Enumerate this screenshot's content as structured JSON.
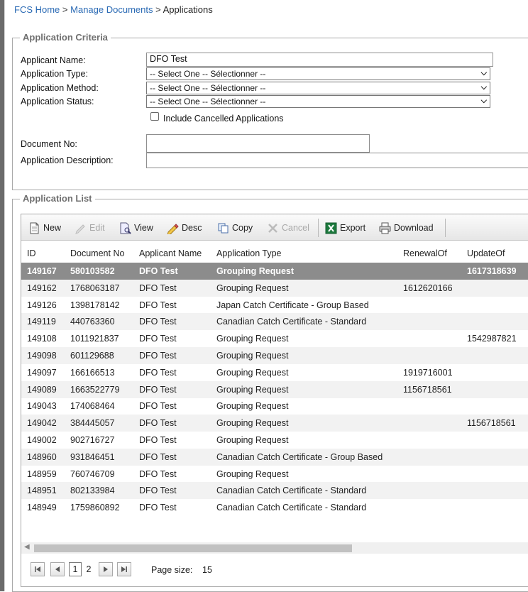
{
  "breadcrumb": {
    "home": "FCS Home",
    "sep1": ">",
    "manage": "Manage Documents",
    "sep2": ">",
    "current": "Applications"
  },
  "criteria": {
    "legend": "Application Criteria",
    "applicant_name_label": "Applicant Name:",
    "applicant_name_value": "DFO Test",
    "application_type_label": "Application Type:",
    "application_type_value": "-- Select One -- Sélectionner --",
    "application_method_label": "Application Method:",
    "application_method_value": "-- Select One -- Sélectionner --",
    "application_status_label": "Application Status:",
    "application_status_value": "-- Select One -- Sélectionner --",
    "include_cancelled_label": "Include Cancelled Applications",
    "document_no_label": "Document No:",
    "document_no_value": "",
    "application_description_label": "Application Description:",
    "application_description_value": ""
  },
  "list": {
    "legend": "Application List",
    "toolbar": {
      "new": "New",
      "edit": "Edit",
      "view": "View",
      "desc": "Desc",
      "copy": "Copy",
      "cancel": "Cancel",
      "export": "Export",
      "download": "Download"
    },
    "columns": {
      "id": "ID",
      "document_no": "Document No",
      "applicant_name": "Applicant Name",
      "application_type": "Application Type",
      "renewal_of": "RenewalOf",
      "update_of": "UpdateOf"
    },
    "rows": [
      {
        "id": "149167",
        "doc": "580103582",
        "name": "DFO Test",
        "type": "Grouping Request",
        "renewal": "",
        "update": "1617318639"
      },
      {
        "id": "149162",
        "doc": "1768063187",
        "name": "DFO Test",
        "type": "Grouping Request",
        "renewal": "1612620166",
        "update": ""
      },
      {
        "id": "149126",
        "doc": "1398178142",
        "name": "DFO Test",
        "type": "Japan Catch Certificate - Group Based",
        "renewal": "",
        "update": ""
      },
      {
        "id": "149119",
        "doc": "440763360",
        "name": "DFO Test",
        "type": "Canadian Catch Certificate - Standard",
        "renewal": "",
        "update": ""
      },
      {
        "id": "149108",
        "doc": "1011921837",
        "name": "DFO Test",
        "type": "Grouping Request",
        "renewal": "",
        "update": "1542987821"
      },
      {
        "id": "149098",
        "doc": "601129688",
        "name": "DFO Test",
        "type": "Grouping Request",
        "renewal": "",
        "update": ""
      },
      {
        "id": "149097",
        "doc": "166166513",
        "name": "DFO Test",
        "type": "Grouping Request",
        "renewal": "1919716001",
        "update": ""
      },
      {
        "id": "149089",
        "doc": "1663522779",
        "name": "DFO Test",
        "type": "Grouping Request",
        "renewal": "1156718561",
        "update": ""
      },
      {
        "id": "149043",
        "doc": "174068464",
        "name": "DFO Test",
        "type": "Grouping Request",
        "renewal": "",
        "update": ""
      },
      {
        "id": "149042",
        "doc": "384445057",
        "name": "DFO Test",
        "type": "Grouping Request",
        "renewal": "",
        "update": "1156718561"
      },
      {
        "id": "149002",
        "doc": "902716727",
        "name": "DFO Test",
        "type": "Grouping Request",
        "renewal": "",
        "update": ""
      },
      {
        "id": "148960",
        "doc": "931846451",
        "name": "DFO Test",
        "type": "Canadian Catch Certificate - Group Based",
        "renewal": "",
        "update": ""
      },
      {
        "id": "148959",
        "doc": "760746709",
        "name": "DFO Test",
        "type": "Grouping Request",
        "renewal": "",
        "update": ""
      },
      {
        "id": "148951",
        "doc": "802133984",
        "name": "DFO Test",
        "type": "Canadian Catch Certificate - Standard",
        "renewal": "",
        "update": ""
      },
      {
        "id": "148949",
        "doc": "1759860892",
        "name": "DFO Test",
        "type": "Canadian Catch Certificate - Standard",
        "renewal": "",
        "update": ""
      }
    ],
    "pager": {
      "page1": "1",
      "page2": "2",
      "page_size_label": "Page size:",
      "page_size_value": "15"
    }
  },
  "colors": {
    "link": "#2a6ab4",
    "selected_row": "#8c8c8c",
    "alt_row": "#f2f2f2"
  }
}
